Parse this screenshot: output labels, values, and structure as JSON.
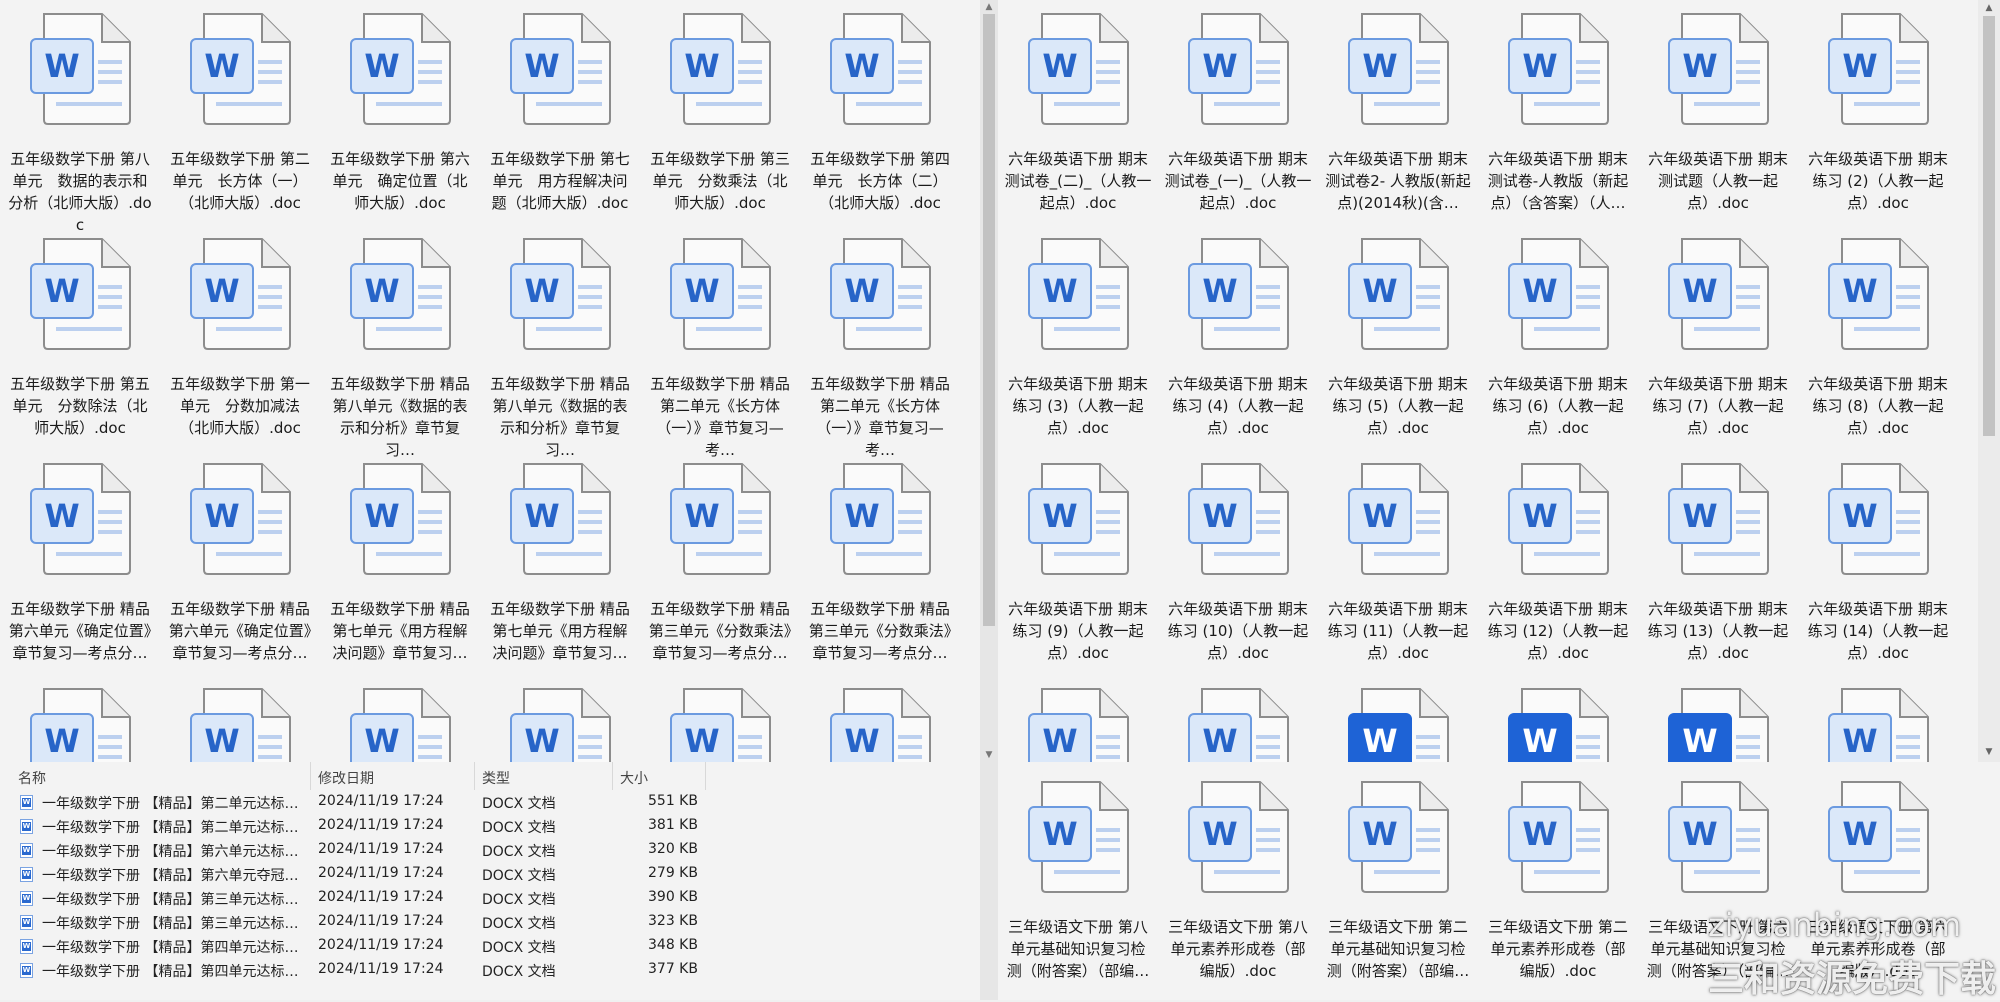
{
  "top_left": {
    "files": [
      "五年级数学下册 第八单元　数据的表示和分析（北师大版）.doc",
      "五年级数学下册 第二单元　长方体（一）（北师大版）.doc",
      "五年级数学下册 第六单元　确定位置（北师大版）.doc",
      "五年级数学下册 第七单元　用方程解决问题（北师大版）.doc",
      "五年级数学下册 第三单元　分数乘法（北师大版）.doc",
      "五年级数学下册 第四单元　长方体（二）（北师大版）.doc",
      "五年级数学下册 第五单元　分数除法（北师大版）.doc",
      "五年级数学下册 第一单元　分数加减法（北师大版）.doc",
      "五年级数学下册 精品 第八单元《数据的表示和分析》章节复习…",
      "五年级数学下册 精品 第八单元《数据的表示和分析》章节复习…",
      "五年级数学下册 精品 第二单元《长方体（一）》章节复习—考…",
      "五年级数学下册 精品 第二单元《长方体（一）》章节复习—考…",
      "五年级数学下册 精品 第六单元《确定位置》章节复习—考点分…",
      "五年级数学下册 精品 第六单元《确定位置》章节复习—考点分…",
      "五年级数学下册 精品 第七单元《用方程解决问题》章节复习…",
      "五年级数学下册 精品 第七单元《用方程解决问题》章节复习…",
      "五年级数学下册 精品 第三单元《分数乘法》章节复习—考点分…",
      "五年级数学下册 精品 第三单元《分数乘法》章节复习—考点分…",
      "",
      "",
      "",
      "",
      "",
      ""
    ]
  },
  "top_right": {
    "files": [
      "六年级英语下册 期末测试卷_(二)_（人教一起点）.doc",
      "六年级英语下册 期末测试卷_(一)_（人教一起点）.doc",
      "六年级英语下册 期末测试卷2- 人教版(新起点)(2014秋)(含…",
      "六年级英语下册 期末测试卷-人教版（新起点）（含答案）（人…",
      "六年级英语下册 期末测试题（人教一起点）.doc",
      "六年级英语下册 期末练习 (2)（人教一起点）.doc",
      "六年级英语下册 期末练习 (3)（人教一起点）.doc",
      "六年级英语下册 期末练习 (4)（人教一起点）.doc",
      "六年级英语下册 期末练习 (5)（人教一起点）.doc",
      "六年级英语下册 期末练习 (6)（人教一起点）.doc",
      "六年级英语下册 期末练习 (7)（人教一起点）.doc",
      "六年级英语下册 期末练习 (8)（人教一起点）.doc",
      "六年级英语下册 期末练习 (9)（人教一起点）.doc",
      "六年级英语下册 期末练习 (10)（人教一起点）.doc",
      "六年级英语下册 期末练习 (11)（人教一起点）.doc",
      "六年级英语下册 期末练习 (12)（人教一起点）.doc",
      "六年级英语下册 期末练习 (13)（人教一起点）.doc",
      "六年级英语下册 期末练习 (14)（人教一起点）.doc",
      "",
      "",
      "",
      "",
      "",
      ""
    ],
    "selected": [
      20,
      21,
      22
    ]
  },
  "bottom_right": {
    "files": [
      "三年级语文下册 第八单元基础知识复习检测（附答案）（部编…",
      "三年级语文下册 第八单元素养形成卷（部编版）.doc",
      "三年级语文下册 第二单元基础知识复习检测（附答案）（部编…",
      "三年级语文下册 第二单元素养形成卷（部编版）.doc",
      "三年级语文下册 第六单元基础知识复习检测（附答案）（部编…",
      "三年级语文下册 第六单元素养形成卷（部编版）.doc"
    ]
  },
  "details": {
    "headers": {
      "name": "名称",
      "date": "修改日期",
      "type": "类型",
      "size": "大小"
    },
    "rows": [
      {
        "name": "一年级数学下册 【精品】第二单元达标…",
        "date": "2024/11/19 17:24",
        "type": "DOCX 文档",
        "size": "551 KB"
      },
      {
        "name": "一年级数学下册 【精品】第二单元达标…",
        "date": "2024/11/19 17:24",
        "type": "DOCX 文档",
        "size": "381 KB"
      },
      {
        "name": "一年级数学下册 【精品】第六单元达标…",
        "date": "2024/11/19 17:24",
        "type": "DOCX 文档",
        "size": "320 KB"
      },
      {
        "name": "一年级数学下册 【精品】第六单元夺冠…",
        "date": "2024/11/19 17:24",
        "type": "DOCX 文档",
        "size": "279 KB"
      },
      {
        "name": "一年级数学下册 【精品】第三单元达标…",
        "date": "2024/11/19 17:24",
        "type": "DOCX 文档",
        "size": "390 KB"
      },
      {
        "name": "一年级数学下册 【精品】第三单元达标…",
        "date": "2024/11/19 17:24",
        "type": "DOCX 文档",
        "size": "323 KB"
      },
      {
        "name": "一年级数学下册 【精品】第四单元达标…",
        "date": "2024/11/19 17:24",
        "type": "DOCX 文档",
        "size": "348 KB"
      },
      {
        "name": "一年级数学下册 【精品】第四单元达标…",
        "date": "2024/11/19 17:24",
        "type": "DOCX 文档",
        "size": "377 KB"
      }
    ]
  },
  "watermark": {
    "line1": "ziyuanbing.com",
    "line2": "三和资源免费下载"
  },
  "colors": {
    "accent": "#2764c8",
    "selected_tile": "#1e63d6",
    "background": "#f3f3f3"
  },
  "icons": {
    "file": "word-document-icon",
    "sort": "sort-ascending-icon",
    "scroll_up": "scroll-up-arrow-icon",
    "scroll_down": "scroll-down-arrow-icon"
  }
}
